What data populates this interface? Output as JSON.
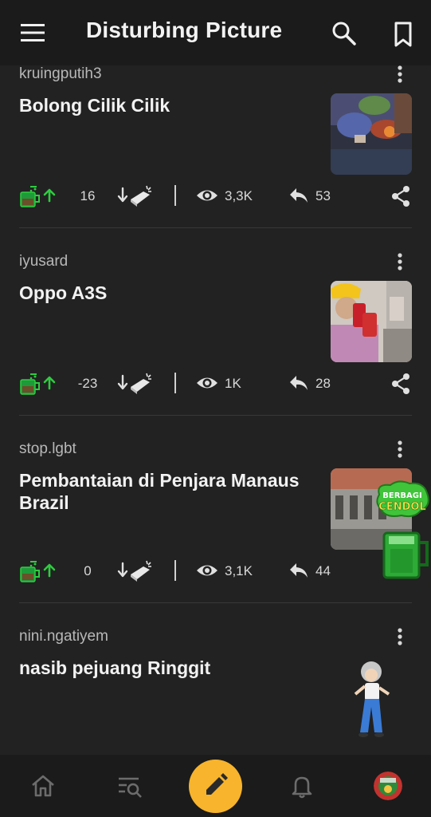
{
  "header": {
    "title": "Disturbing Picture",
    "menu_icon": "hamburger-menu-icon",
    "search_icon": "search-icon",
    "bookmark_icon": "bookmark-icon"
  },
  "posts": [
    {
      "user": "kruingputih3",
      "title": "Bolong Cilik Cilik",
      "score": "16",
      "views": "3,3K",
      "replies": "53",
      "thumbnail": "photo-thumbnail"
    },
    {
      "user": "iyusard",
      "title": "Oppo A3S",
      "score": "-23",
      "views": "1K",
      "replies": "28",
      "thumbnail": "photo-thumbnail"
    },
    {
      "user": "stop.lgbt",
      "title": "Pembantaian di Penjara Manaus Brazil",
      "score": "0",
      "views": "3,1K",
      "replies": "44",
      "thumbnail": "photo-thumbnail"
    },
    {
      "user": "nini.ngatiyem",
      "title": "nasib pejuang Ringgit"
    }
  ],
  "promo": {
    "line1": "BERBAGI",
    "line2": "CENDOL"
  },
  "bottom_nav": {
    "items": [
      "home-icon",
      "search-thread-icon",
      "create-post-icon",
      "notification-bell-icon",
      "profile-avatar"
    ]
  },
  "colors": {
    "accent": "#f7b42c",
    "upvote": "#2ecc40",
    "background": "#222222",
    "bar": "#1b1b1b"
  }
}
